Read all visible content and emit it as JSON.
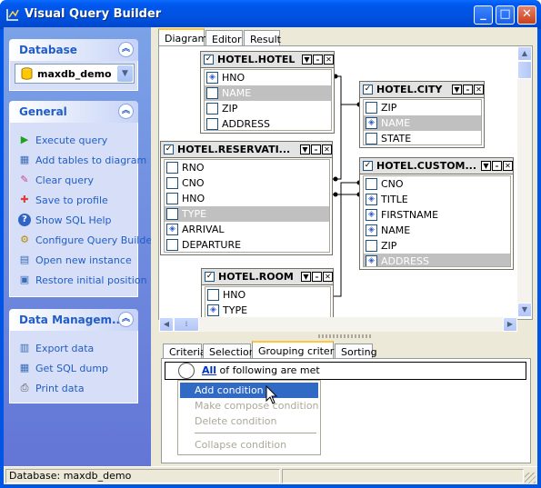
{
  "window": {
    "title": "Visual Query Builder"
  },
  "sidebar": {
    "database": {
      "header": "Database",
      "selected": "maxdb_demo"
    },
    "general": {
      "header": "General",
      "items": [
        {
          "label": "Execute query",
          "icon": "play-icon"
        },
        {
          "label": "Add tables to diagram",
          "icon": "table-add-icon"
        },
        {
          "label": "Clear query",
          "icon": "eraser-icon"
        },
        {
          "label": "Save to profile",
          "icon": "save-icon"
        },
        {
          "label": "Show SQL Help",
          "icon": "help-icon"
        },
        {
          "label": "Configure Query Builder",
          "icon": "configure-icon"
        },
        {
          "label": "Open new instance",
          "icon": "new-window-icon"
        },
        {
          "label": "Restore initial position",
          "icon": "restore-icon"
        }
      ]
    },
    "data_management": {
      "header": "Data Managem...",
      "items": [
        {
          "label": "Export data",
          "icon": "export-icon"
        },
        {
          "label": "Get SQL dump",
          "icon": "dump-icon"
        },
        {
          "label": "Print data",
          "icon": "print-icon"
        }
      ]
    }
  },
  "main_tabs": [
    {
      "label": "Diagram"
    },
    {
      "label": "Editor"
    },
    {
      "label": "Result"
    }
  ],
  "diagram": {
    "tables": [
      {
        "name": "HOTEL.HOTEL",
        "fields": [
          {
            "name": "HNO",
            "key": true,
            "checked": false
          },
          {
            "name": "NAME",
            "key": false,
            "checked": false,
            "selected": true
          },
          {
            "name": "ZIP",
            "key": false,
            "checked": false
          },
          {
            "name": "ADDRESS",
            "key": false,
            "checked": false
          }
        ]
      },
      {
        "name": "HOTEL.CITY",
        "fields": [
          {
            "name": "ZIP",
            "key": false,
            "checked": false
          },
          {
            "name": "NAME",
            "key": true,
            "checked": false,
            "selected": true
          },
          {
            "name": "STATE",
            "key": false,
            "checked": false
          }
        ]
      },
      {
        "name": "HOTEL.RESERVATI...",
        "fields": [
          {
            "name": "RNO",
            "key": false,
            "checked": false
          },
          {
            "name": "CNO",
            "key": false,
            "checked": false
          },
          {
            "name": "HNO",
            "key": false,
            "checked": false
          },
          {
            "name": "TYPE",
            "key": false,
            "checked": false,
            "selected": true
          },
          {
            "name": "ARRIVAL",
            "key": true,
            "checked": false
          },
          {
            "name": "DEPARTURE",
            "key": false,
            "checked": false
          }
        ]
      },
      {
        "name": "HOTEL.CUSTOM...",
        "fields": [
          {
            "name": "CNO",
            "key": false,
            "checked": false
          },
          {
            "name": "TITLE",
            "key": true,
            "checked": false
          },
          {
            "name": "FIRSTNAME",
            "key": true,
            "checked": false
          },
          {
            "name": "NAME",
            "key": true,
            "checked": false
          },
          {
            "name": "ZIP",
            "key": false,
            "checked": false
          },
          {
            "name": "ADDRESS",
            "key": true,
            "checked": false,
            "selected": true
          }
        ]
      },
      {
        "name": "HOTEL.ROOM",
        "fields": [
          {
            "name": "HNO",
            "key": false,
            "checked": false
          },
          {
            "name": "TYPE",
            "key": true,
            "checked": false
          }
        ]
      }
    ]
  },
  "criteria_tabs": [
    {
      "label": "Criteria"
    },
    {
      "label": "Selection"
    },
    {
      "label": "Grouping criteria"
    },
    {
      "label": "Sorting"
    }
  ],
  "grouping": {
    "all_link": "All",
    "rest_text": " of following are met",
    "menu": [
      {
        "label": "Add condition",
        "enabled": true
      },
      {
        "label": "Make compose condition",
        "enabled": false
      },
      {
        "label": "Delete condition",
        "enabled": false
      },
      {
        "label": "Collapse condition",
        "enabled": false
      }
    ]
  },
  "status": {
    "database": "Database: maxdb_demo"
  },
  "colors": {
    "titlebar": "#0058ee",
    "sidebar": "#6f8cde",
    "link": "#215dc6",
    "menu_highlight": "#316ac5"
  }
}
